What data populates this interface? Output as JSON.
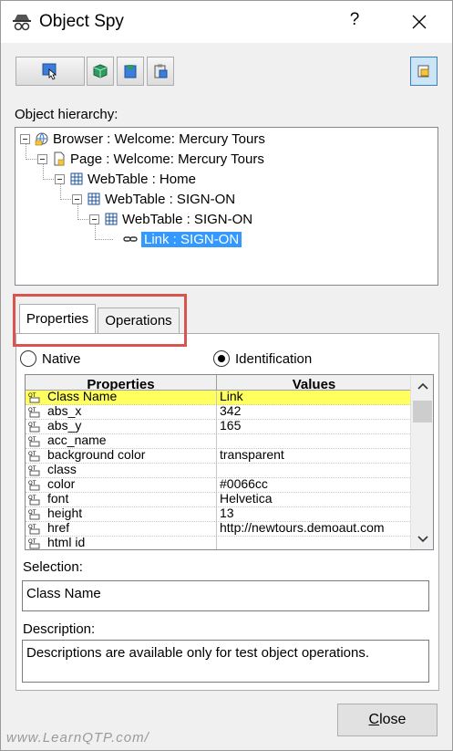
{
  "window": {
    "title": "Object Spy",
    "help_label": "?"
  },
  "labels": {
    "object_hierarchy": "Object hierarchy:",
    "selection": "Selection:",
    "description": "Description:"
  },
  "tree": [
    {
      "text": "Browser : Welcome: Mercury Tours",
      "icon": "browser-icon",
      "selected": false
    },
    {
      "text": "Page : Welcome: Mercury Tours",
      "icon": "page-icon",
      "selected": false
    },
    {
      "text": "WebTable : Home",
      "icon": "table-icon",
      "selected": false
    },
    {
      "text": "WebTable : SIGN-ON",
      "icon": "table-icon",
      "selected": false
    },
    {
      "text": "WebTable : SIGN-ON",
      "icon": "table-icon",
      "selected": false
    },
    {
      "text": "Link : SIGN-ON",
      "icon": "link-icon",
      "selected": true
    }
  ],
  "tabs": [
    {
      "label": "Properties",
      "active": true
    },
    {
      "label": "Operations",
      "active": false
    }
  ],
  "radios": {
    "native": {
      "label": "Native",
      "checked": false
    },
    "identification": {
      "label": "Identification",
      "checked": true
    }
  },
  "grid": {
    "headers": [
      "Properties",
      "Values"
    ],
    "rows": [
      [
        "Class Name",
        "Link"
      ],
      [
        "abs_x",
        "342"
      ],
      [
        "abs_y",
        "165"
      ],
      [
        "acc_name",
        ""
      ],
      [
        "background color",
        "transparent"
      ],
      [
        "class",
        ""
      ],
      [
        "color",
        "#0066cc"
      ],
      [
        "font",
        "Helvetica"
      ],
      [
        "height",
        "13"
      ],
      [
        "href",
        "http://newtours.demoaut.com"
      ],
      [
        "html id",
        ""
      ]
    ],
    "highlight_row": 0
  },
  "selection_value": "Class Name",
  "description_value": "Descriptions are available only for test object operations.",
  "close_label_prefix": "",
  "close_label_underlined": "C",
  "close_label_rest": "lose",
  "watermark": "www.LearnQTP.com/",
  "colors": {
    "selection": "#3399ff",
    "highlight_row": "#ffff60",
    "callout": "#d9534f"
  }
}
